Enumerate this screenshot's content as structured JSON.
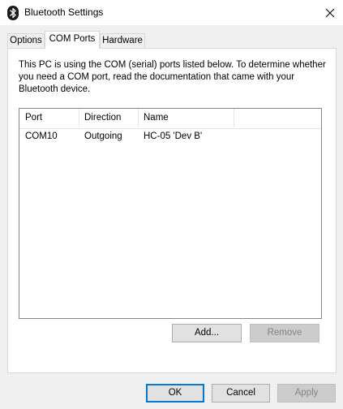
{
  "window": {
    "title": "Bluetooth Settings"
  },
  "tabs": [
    {
      "label": "Options",
      "active": false
    },
    {
      "label": "COM Ports",
      "active": true
    },
    {
      "label": "Hardware",
      "active": false
    }
  ],
  "panel": {
    "description": "This PC is using the COM (serial) ports listed below. To determine whether you need a COM port, read the documentation that came with your Bluetooth device.",
    "columns": {
      "port": "Port",
      "direction": "Direction",
      "name": "Name"
    },
    "rows": [
      {
        "port": "COM10",
        "direction": "Outgoing",
        "name": "HC-05 'Dev B'"
      }
    ],
    "add_label": "Add...",
    "remove_label": "Remove"
  },
  "footer": {
    "ok_label": "OK",
    "cancel_label": "Cancel",
    "apply_label": "Apply"
  },
  "icons": {
    "app": "bluetooth-icon",
    "close": "close-icon"
  },
  "colors": {
    "bluetooth_icon": "#1a1a1a",
    "default_button_border": "#0078d7",
    "disabled_text": "#838383"
  }
}
